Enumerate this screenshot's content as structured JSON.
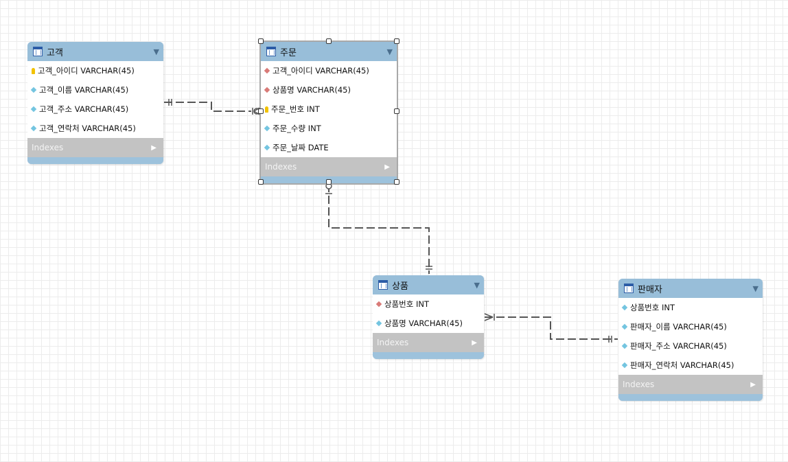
{
  "colors": {
    "pk": "#f2c200",
    "fk": "#d97a77",
    "col": "#74c5e0",
    "line": "#555555"
  },
  "tables": [
    {
      "name": "고객",
      "columns": [
        {
          "text": "고객_아이디 VARCHAR(45)",
          "kind": "pk"
        },
        {
          "text": "고객_이름 VARCHAR(45)",
          "kind": "col"
        },
        {
          "text": "고객_주소 VARCHAR(45)",
          "kind": "col"
        },
        {
          "text": "고객_연락처 VARCHAR(45)",
          "kind": "col"
        }
      ],
      "indexes_label": "Indexes"
    },
    {
      "name": "주문",
      "columns": [
        {
          "text": "고객_아이디 VARCHAR(45)",
          "kind": "fk"
        },
        {
          "text": "상품명 VARCHAR(45)",
          "kind": "fk"
        },
        {
          "text": "주문_번호 INT",
          "kind": "pk"
        },
        {
          "text": "주문_수량 INT",
          "kind": "col"
        },
        {
          "text": "주문_날짜 DATE",
          "kind": "col"
        }
      ],
      "indexes_label": "Indexes"
    },
    {
      "name": "상품",
      "columns": [
        {
          "text": "상품번호 INT",
          "kind": "fk"
        },
        {
          "text": "상품명 VARCHAR(45)",
          "kind": "col"
        }
      ],
      "indexes_label": "Indexes"
    },
    {
      "name": "판매자",
      "columns": [
        {
          "text": "상품번호 INT",
          "kind": "col"
        },
        {
          "text": "판매자_이름 VARCHAR(45)",
          "kind": "col"
        },
        {
          "text": "판매자_주소 VARCHAR(45)",
          "kind": "col"
        },
        {
          "text": "판매자_연락처 VARCHAR(45)",
          "kind": "col"
        }
      ],
      "indexes_label": "Indexes"
    }
  ],
  "relationships": [
    {
      "from": "고객",
      "to": "주문",
      "from_end": "one-mandatory",
      "to_end": "many-optional"
    },
    {
      "from": "주문",
      "to": "상품",
      "from_end": "one-optional",
      "to_end": "one-mandatory"
    },
    {
      "from": "상품",
      "to": "판매자",
      "from_end": "many-mandatory",
      "to_end": "one-mandatory"
    }
  ]
}
